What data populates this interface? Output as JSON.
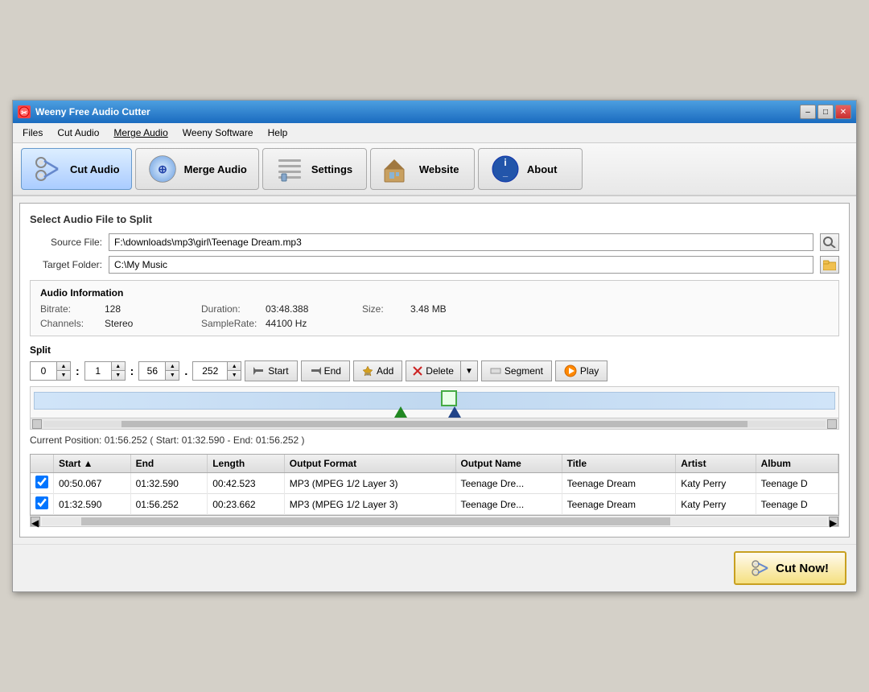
{
  "window": {
    "title": "Weeny Free Audio Cutter",
    "min_label": "–",
    "max_label": "□",
    "close_label": "✕"
  },
  "menu": {
    "items": [
      {
        "label": "Files",
        "underline": false
      },
      {
        "label": "Cut Audio",
        "underline": false
      },
      {
        "label": "Merge Audio",
        "underline": true
      },
      {
        "label": "Weeny Software",
        "underline": false
      },
      {
        "label": "Help",
        "underline": false
      }
    ]
  },
  "toolbar": {
    "buttons": [
      {
        "label": "Cut Audio",
        "active": true
      },
      {
        "label": "Merge Audio",
        "active": false
      },
      {
        "label": "Settings",
        "active": false
      },
      {
        "label": "Website",
        "active": false
      },
      {
        "label": "About",
        "active": false
      }
    ]
  },
  "form": {
    "section_title": "Select Audio File to Split",
    "source_label": "Source File:",
    "source_value": "F:\\downloads\\mp3\\girl\\Teenage Dream.mp3",
    "target_label": "Target Folder:",
    "target_value": "C:\\My Music"
  },
  "audio_info": {
    "title": "Audio Information",
    "bitrate_label": "Bitrate:",
    "bitrate_value": "128",
    "duration_label": "Duration:",
    "duration_value": "03:48.388",
    "size_label": "Size:",
    "size_value": "3.48 MB",
    "channels_label": "Channels:",
    "channels_value": "Stereo",
    "samplerate_label": "SampleRate:",
    "samplerate_value": "44100 Hz"
  },
  "split": {
    "title": "Split",
    "spin_h": "0",
    "spin_m": "1",
    "spin_s": "56",
    "spin_ms": "252",
    "start_btn": "Start",
    "end_btn": "End",
    "add_btn": "Add",
    "delete_btn": "Delete",
    "segment_btn": "Segment",
    "play_btn": "Play"
  },
  "timeline": {
    "position_text": "Current Position: 01:56.252 ( Start: 01:32.590 - End: 01:56.252 )"
  },
  "table": {
    "columns": [
      "",
      "Start",
      "End",
      "Length",
      "Output Format",
      "Output Name",
      "Title",
      "Artist",
      "Album"
    ],
    "rows": [
      {
        "checked": true,
        "start": "00:50.067",
        "end": "01:32.590",
        "length": "00:42.523",
        "format": "MP3 (MPEG 1/2 Layer 3)",
        "output_name": "Teenage Dre...",
        "title": "Teenage Dream",
        "artist": "Katy Perry",
        "album": "Teenage D"
      },
      {
        "checked": true,
        "start": "01:32.590",
        "end": "01:56.252",
        "length": "00:23.662",
        "format": "MP3 (MPEG 1/2 Layer 3)",
        "output_name": "Teenage Dre...",
        "title": "Teenage Dream",
        "artist": "Katy Perry",
        "album": "Teenage D"
      }
    ]
  },
  "bottom": {
    "cut_now_label": "Cut Now!"
  }
}
